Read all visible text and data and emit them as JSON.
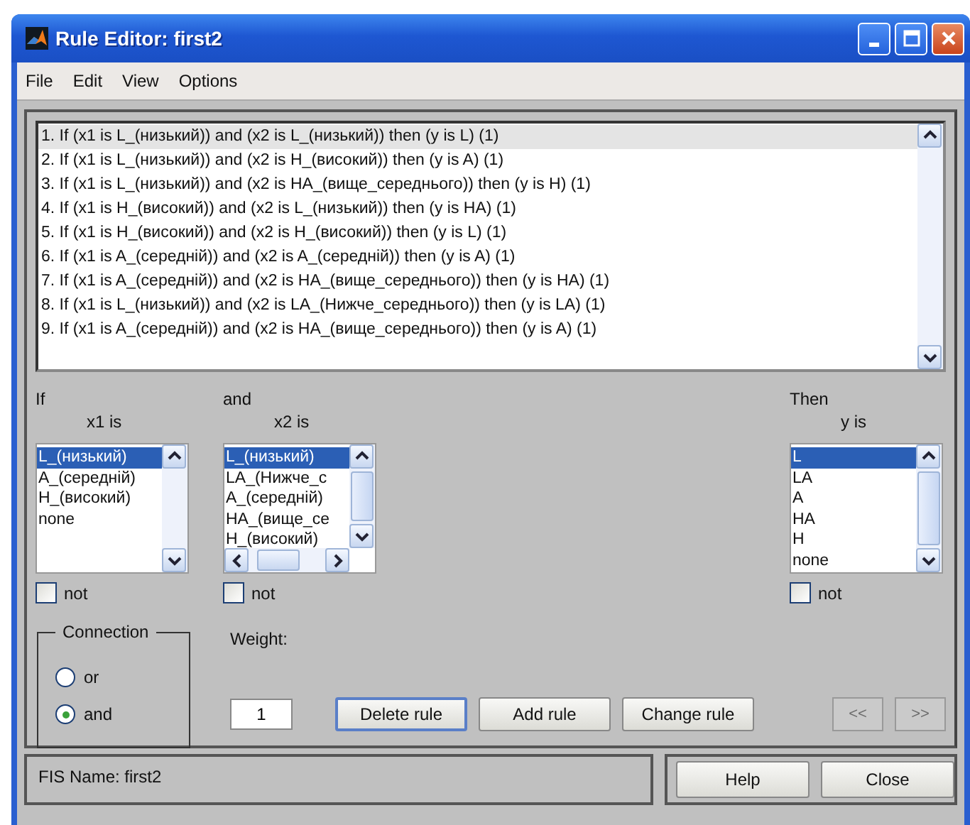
{
  "window": {
    "title": "Rule Editor: first2"
  },
  "menu": [
    "File",
    "Edit",
    "View",
    "Options"
  ],
  "rules": [
    {
      "text": "1. If (x1 is L_(низький)) and (x2 is L_(низький)) then (y is L) (1)",
      "selected": true
    },
    {
      "text": "2. If (x1 is L_(низький)) and (x2 is H_(високий)) then (y is A) (1)",
      "selected": false
    },
    {
      "text": "3. If (x1 is L_(низький)) and (x2 is HA_(вище_середнього)) then (y is H) (1)",
      "selected": false
    },
    {
      "text": "4. If (x1 is H_(високий)) and (x2 is L_(низький)) then (y is HA) (1)",
      "selected": false
    },
    {
      "text": "5. If (x1 is H_(високий)) and (x2 is H_(високий)) then (y is L) (1)",
      "selected": false
    },
    {
      "text": "6. If (x1 is A_(середній)) and (x2 is A_(середній)) then (y is A) (1)",
      "selected": false
    },
    {
      "text": "7. If (x1 is A_(середній)) and (x2 is HA_(вище_середнього)) then (y is HA) (1)",
      "selected": false
    },
    {
      "text": "8. If (x1 is L_(низький)) and (x2 is LA_(Нижче_середнього)) then (y is LA) (1)",
      "selected": false
    },
    {
      "text": "9. If (x1 is A_(середній)) and (x2 is HA_(вище_середнього)) then (y is A) (1)",
      "selected": false
    }
  ],
  "variables": [
    {
      "heading": "If",
      "label": "x1 is",
      "horizontal_scroll": false,
      "not_checked": false,
      "items": [
        {
          "text": "L_(низький)",
          "selected": true
        },
        {
          "text": "A_(середній)",
          "selected": false
        },
        {
          "text": "H_(високий)",
          "selected": false
        },
        {
          "text": "none",
          "selected": false
        }
      ]
    },
    {
      "heading": "and",
      "label": "x2 is",
      "horizontal_scroll": true,
      "not_checked": false,
      "items": [
        {
          "text": "L_(низький)",
          "selected": true
        },
        {
          "text": "LA_(Нижче_с",
          "selected": false
        },
        {
          "text": "A_(середній)",
          "selected": false
        },
        {
          "text": "HA_(вище_се",
          "selected": false
        },
        {
          "text": "H_(високий)",
          "selected": false
        }
      ]
    },
    {
      "heading": "Then",
      "label": "y is",
      "horizontal_scroll": false,
      "not_checked": false,
      "items": [
        {
          "text": "L",
          "selected": true
        },
        {
          "text": "LA",
          "selected": false
        },
        {
          "text": "A",
          "selected": false
        },
        {
          "text": "HA",
          "selected": false
        },
        {
          "text": "H",
          "selected": false
        },
        {
          "text": "none",
          "selected": false
        }
      ]
    }
  ],
  "not_labels": [
    "not",
    "not",
    "not"
  ],
  "connection": {
    "label": "Connection",
    "options": [
      {
        "label": "or",
        "selected": false
      },
      {
        "label": "and",
        "selected": true
      }
    ]
  },
  "weight": {
    "label": "Weight:",
    "value": "1"
  },
  "rule_buttons": [
    {
      "label": "Delete rule",
      "focused": true
    },
    {
      "label": "Add rule",
      "focused": false
    },
    {
      "label": "Change rule",
      "focused": false
    }
  ],
  "nav_buttons": [
    {
      "label": "<<",
      "disabled": true
    },
    {
      "label": ">>",
      "disabled": true
    }
  ],
  "status": "FIS Name: first2",
  "footer_buttons": [
    "Help",
    "Close"
  ]
}
